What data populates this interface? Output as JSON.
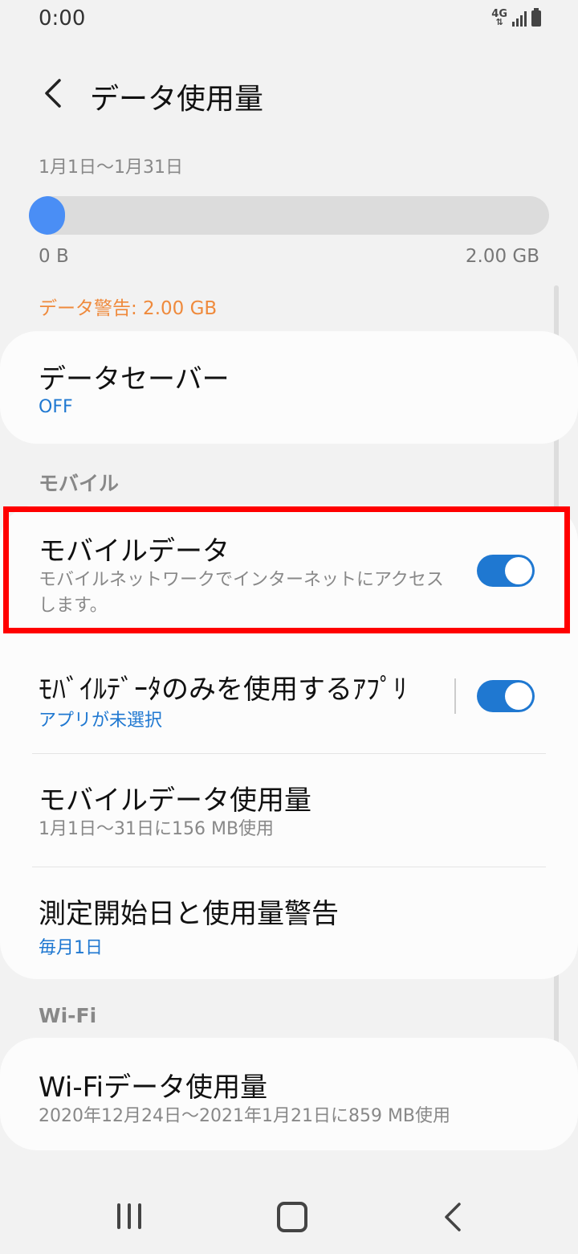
{
  "status_bar": {
    "time": "0:00",
    "network": "4G"
  },
  "header": {
    "title": "データ使用量"
  },
  "usage": {
    "period": "1月1日〜1月31日",
    "used_fraction": 0.07,
    "range_min": "0 B",
    "range_max": "2.00 GB",
    "warning": "データ警告: 2.00 GB",
    "progress_color": "#4a8ef5",
    "warning_color": "#ef8a3c"
  },
  "data_saver": {
    "title": "データセーバー",
    "status": "OFF"
  },
  "mobile_section": {
    "header": "モバイル",
    "mobile_data": {
      "title": "モバイルデータ",
      "subtitle": "モバイルネットワークでインターネットにアクセスします。",
      "enabled": true
    },
    "mobile_only_apps": {
      "title": "ﾓﾊﾞｲﾙﾃﾞｰﾀのみを使用するｱﾌﾟﾘ",
      "subtitle": "アプリが未選択",
      "enabled": true
    },
    "mobile_usage": {
      "title": "モバイルデータ使用量",
      "subtitle": "1月1日〜31日に156 MB使用"
    },
    "billing_cycle": {
      "title": "測定開始日と使用量警告",
      "subtitle": "毎月1日"
    }
  },
  "wifi_section": {
    "header": "Wi-Fi",
    "wifi_usage": {
      "title": "Wi-Fiデータ使用量",
      "subtitle": "2020年12月24日〜2021年1月21日に859 MB使用"
    }
  },
  "colors": {
    "accent": "#1f78d1",
    "highlight": "#ff0000"
  }
}
